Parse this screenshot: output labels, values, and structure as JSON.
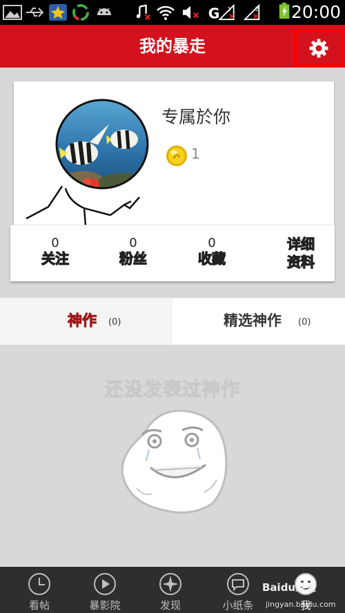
{
  "status_bar": {
    "time": "20:00",
    "icons": [
      "image-icon",
      "usb-icon",
      "star-app-icon",
      "sync-icon",
      "android-icon",
      "music-muted-icon",
      "wifi-icon",
      "volume-muted-icon",
      "signal-1-icon",
      "signal-2-icon",
      "battery-charging-icon"
    ]
  },
  "header": {
    "title": "我的暴走",
    "settings_icon": "gear-icon"
  },
  "profile": {
    "username": "专属於你",
    "coin_icon": "coin-icon",
    "coin_count": "1"
  },
  "stats": [
    {
      "count": "0",
      "label": "关注"
    },
    {
      "count": "0",
      "label": "粉丝"
    },
    {
      "count": "0",
      "label": "收藏"
    }
  ],
  "detail": {
    "line1": "详细",
    "line2": "资料"
  },
  "tabs": [
    {
      "label": "神作",
      "count": "(0)"
    },
    {
      "label": "精选神作",
      "count": "(0)"
    }
  ],
  "empty_state": {
    "text": "还没发表过神作"
  },
  "bottom_nav": [
    {
      "label": "看帖",
      "icon": "clock-icon"
    },
    {
      "label": "暴影院",
      "icon": "play-icon"
    },
    {
      "label": "发现",
      "icon": "compass-icon"
    },
    {
      "label": "小纸条",
      "icon": "chat-bubble-icon"
    },
    {
      "label": "我",
      "icon": "me-avatar-icon"
    }
  ],
  "watermark": {
    "text": "Baidu经验",
    "sub": "jingyan.baidu.com"
  },
  "colors": {
    "brand_red": "#d4121e",
    "nav_bg": "#2e2e2e",
    "highlight_border": "#ff0000"
  }
}
